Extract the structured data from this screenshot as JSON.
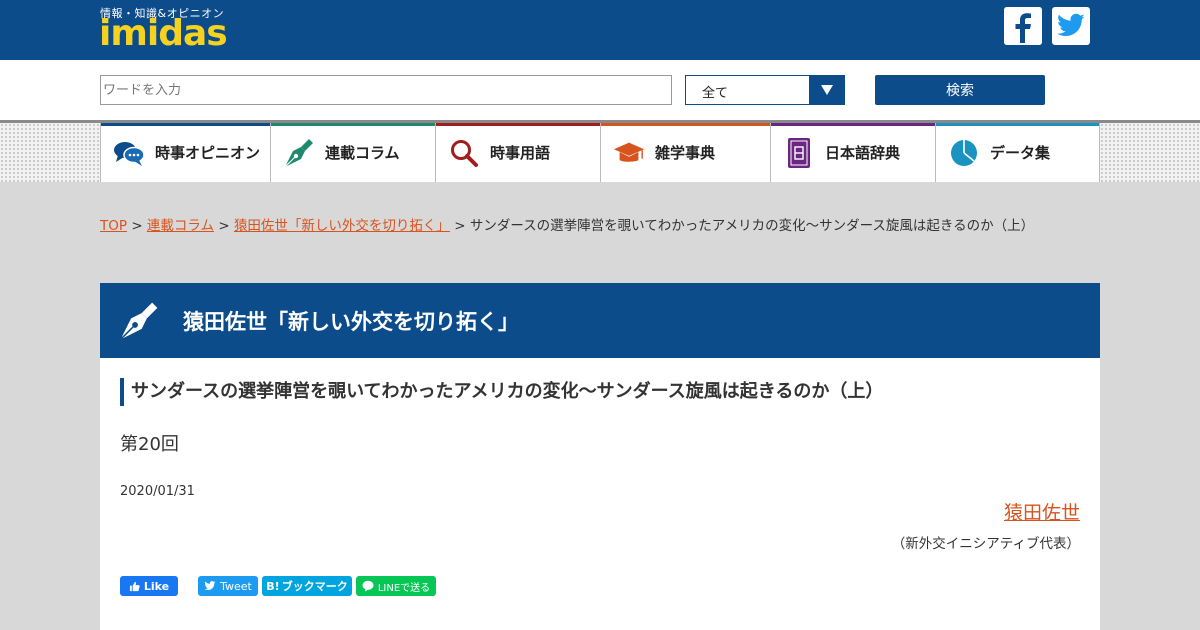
{
  "header": {
    "logo_tagline": "情報・知識&オピニオン",
    "logo_text": "imidas",
    "logo_color": "#f5d21f",
    "social": [
      {
        "name": "facebook",
        "icon": "facebook-icon"
      },
      {
        "name": "twitter",
        "icon": "twitter-icon"
      }
    ]
  },
  "search": {
    "placeholder": "ワードを入力",
    "value": "",
    "category_selected": "全て",
    "button_label": "検索"
  },
  "nav": {
    "items": [
      {
        "label": "時事オピニオン",
        "icon": "speech-bubbles-icon",
        "color": "#0d4c8b"
      },
      {
        "label": "連載コラム",
        "icon": "pen-nib-icon",
        "color": "#1d8a6e"
      },
      {
        "label": "時事用語",
        "icon": "magnifier-icon",
        "color": "#a21d1d"
      },
      {
        "label": "雑学事典",
        "icon": "mortarboard-icon",
        "color": "#d9531e"
      },
      {
        "label": "日本語辞典",
        "icon": "dictionary-book-icon",
        "color": "#6a2680"
      },
      {
        "label": "データ集",
        "icon": "pie-chart-icon",
        "color": "#1a93c0"
      }
    ]
  },
  "breadcrumb": {
    "top": "TOP",
    "sep": ">",
    "column": "連載コラム",
    "series": "猿田佐世「新しい外交を切り拓く」",
    "current": "サンダースの選挙陣営を覗いてわかったアメリカの変化～サンダース旋風は起きるのか（上）"
  },
  "section": {
    "title": "猿田佐世「新しい外交を切り拓く」",
    "icon": "pen-nib-icon"
  },
  "article": {
    "title": "サンダースの選挙陣営を覗いてわかったアメリカの変化～サンダース旋風は起きるのか（上）",
    "episode": "第20回",
    "date": "2020/01/31",
    "author": "猿田佐世",
    "author_role": "（新外交イニシアティブ代表）"
  },
  "share": {
    "facebook": "Like",
    "twitter": "Tweet",
    "hatena": "ブックマーク",
    "line": "LINEで送る"
  },
  "colors": {
    "brand_blue": "#0d4c8b",
    "link_orange": "#d9531e"
  }
}
